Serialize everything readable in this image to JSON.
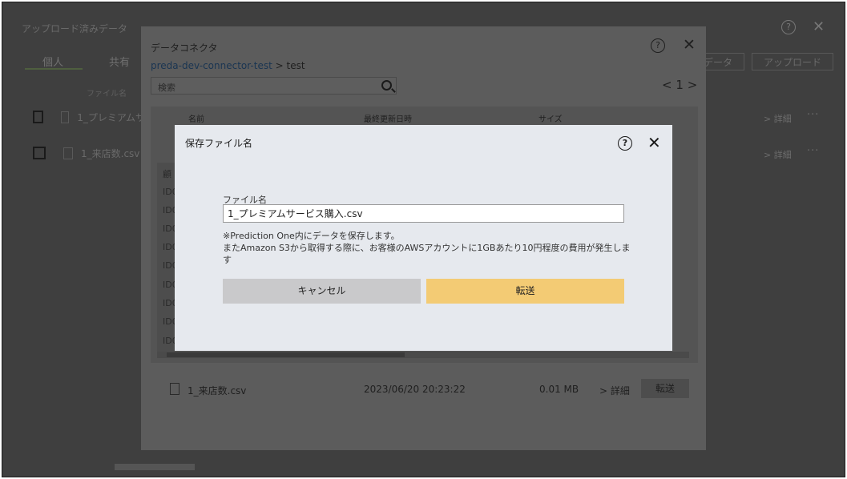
{
  "background_app": {
    "title": "アップロード済みデータ",
    "help_icon": "question-circle-icon",
    "tabs": [
      {
        "label": "個人"
      },
      {
        "label": "共有"
      }
    ],
    "buttons": [
      {
        "label": "データ"
      },
      {
        "label": "アップロード"
      }
    ],
    "file_column_header": "ファイル名",
    "files": [
      {
        "name": "1_プレミアムサ"
      },
      {
        "name": "1_来店数.csv"
      }
    ],
    "row_action": "> 詳細",
    "more": "···"
  },
  "connector_dialog": {
    "title": "データコネクタ",
    "breadcrumb": {
      "link": "preda-dev-connector-test",
      "separator": " > ",
      "current": "test"
    },
    "search": {
      "placeholder": "検索"
    },
    "pager": {
      "prev": "<",
      "page": "1",
      "next": ">"
    },
    "columns": {
      "name": "名前",
      "modified": "最終更新日時",
      "size": "サイズ"
    },
    "preview_cells": [
      "顧",
      "ID0",
      "ID0",
      "ID0",
      "ID0",
      "ID0",
      "ID0",
      "ID0",
      "ID0",
      "ID0"
    ],
    "file_row": {
      "name": "1_来店数.csv",
      "modified": "2023/06/20 20:23:22",
      "size": "0.01 MB",
      "detail_label": "> 詳細",
      "transfer_label": "転送"
    }
  },
  "save_modal": {
    "title": "保存ファイル名",
    "field_label": "ファイル名",
    "file_name_value": "1_プレミアムサービス購入.csv",
    "note_line1": "※Prediction One内にデータを保存します。",
    "note_line2": "またAmazon S3から取得する際に、お客様のAWSアカウントに1GBあたり10円程度の費用が発生しま",
    "note_line3": "す",
    "cancel_label": "キャンセル",
    "transfer_label": "転送",
    "colors": {
      "transfer_button": "#f3cb74",
      "cancel_button": "#c9c9cb",
      "background": "#e6e9ee"
    }
  }
}
